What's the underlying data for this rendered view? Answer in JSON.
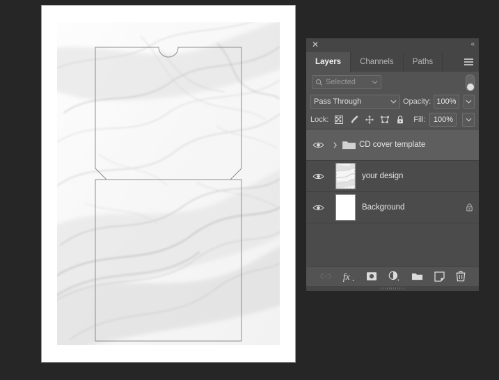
{
  "app": {
    "background_color": "#262626",
    "panel_background": "#535353",
    "list_background": "#4b4b4b",
    "selected_row_color": "#5e5e5e",
    "text_color": "#e3e3e3"
  },
  "document": {
    "page_background": "#ffffff",
    "artwork_description": "white marble texture",
    "template_name": "CD sleeve template outline"
  },
  "panel": {
    "titlebar": {
      "close_icon": "close-icon",
      "close_glyph": "✕",
      "collapse_icon": "collapse-panel-icon",
      "collapse_glyph": "«"
    },
    "tabs": [
      {
        "label": "Layers",
        "active": true
      },
      {
        "label": "Channels",
        "active": false
      },
      {
        "label": "Paths",
        "active": false
      }
    ],
    "menu_icon": "panel-menu-icon",
    "filter": {
      "search_icon": "search-icon",
      "value": "Selected",
      "placeholder": "Selected",
      "dropdown_icon": "chevron-down-icon",
      "toggle_icon": "filter-toggle-switch",
      "toggle_on": true
    },
    "blend": {
      "mode": "Pass Through",
      "mode_dropdown_icon": "chevron-down-icon",
      "opacity_label": "Opacity:",
      "opacity_value": "100%",
      "opacity_stepper_icon": "chevron-down-icon"
    },
    "lock": {
      "label": "Lock:",
      "icons": [
        "lock-transparent-pixels-icon",
        "lock-image-pixels-icon",
        "lock-position-icon",
        "lock-artboard-nesting-icon",
        "lock-all-icon"
      ],
      "fill_label": "Fill:",
      "fill_value": "100%",
      "fill_stepper_icon": "chevron-down-icon"
    },
    "layers": [
      {
        "name": "CD cover template",
        "type": "group",
        "selected": true,
        "visible": true,
        "expand_icon": "chevron-right-icon",
        "folder_icon": "folder-icon",
        "eye_icon": "eye-icon",
        "locked": false,
        "thumbnail": "none"
      },
      {
        "name": "your design",
        "type": "layer",
        "selected": false,
        "visible": true,
        "eye_icon": "eye-icon",
        "locked": false,
        "thumbnail": "marble"
      },
      {
        "name": "Background",
        "type": "layer",
        "selected": false,
        "visible": true,
        "eye_icon": "eye-icon",
        "locked": true,
        "lock_icon": "lock-icon",
        "thumbnail": "white"
      }
    ],
    "footer_icons": [
      {
        "name": "link-layers-icon",
        "glyph": "link",
        "disabled": true
      },
      {
        "name": "layer-style-fx-icon",
        "glyph": "fx",
        "disabled": false
      },
      {
        "name": "add-layer-mask-icon",
        "glyph": "mask",
        "disabled": false
      },
      {
        "name": "adjustment-layer-icon",
        "glyph": "halfcircle",
        "disabled": false
      },
      {
        "name": "new-group-icon",
        "glyph": "folder",
        "disabled": false
      },
      {
        "name": "new-layer-icon",
        "glyph": "newlayer",
        "disabled": false
      },
      {
        "name": "delete-layer-icon",
        "glyph": "trash",
        "disabled": false
      }
    ]
  }
}
